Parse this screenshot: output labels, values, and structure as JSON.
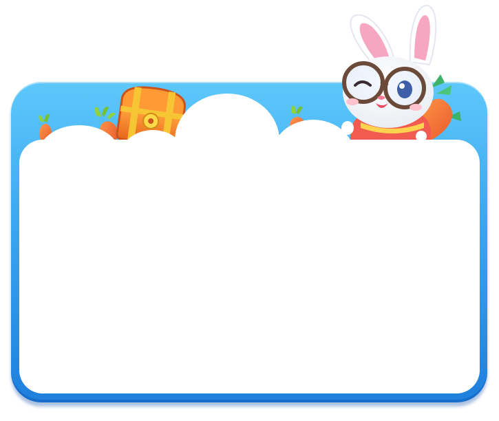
{
  "theme": {
    "frame_top_color": "#5ec8fb",
    "frame_bottom_color": "#1f7fdc",
    "panel_color": "#ffffff",
    "carrot_color": "#f77b3a",
    "chest_color": "#f7892b",
    "bunny_shirt_color": "#f25b4f"
  },
  "decorations": {
    "mascot": "bunny-with-glasses",
    "items": [
      "treasure-chest",
      "carrot",
      "carrot",
      "carrot",
      "clouds"
    ]
  }
}
